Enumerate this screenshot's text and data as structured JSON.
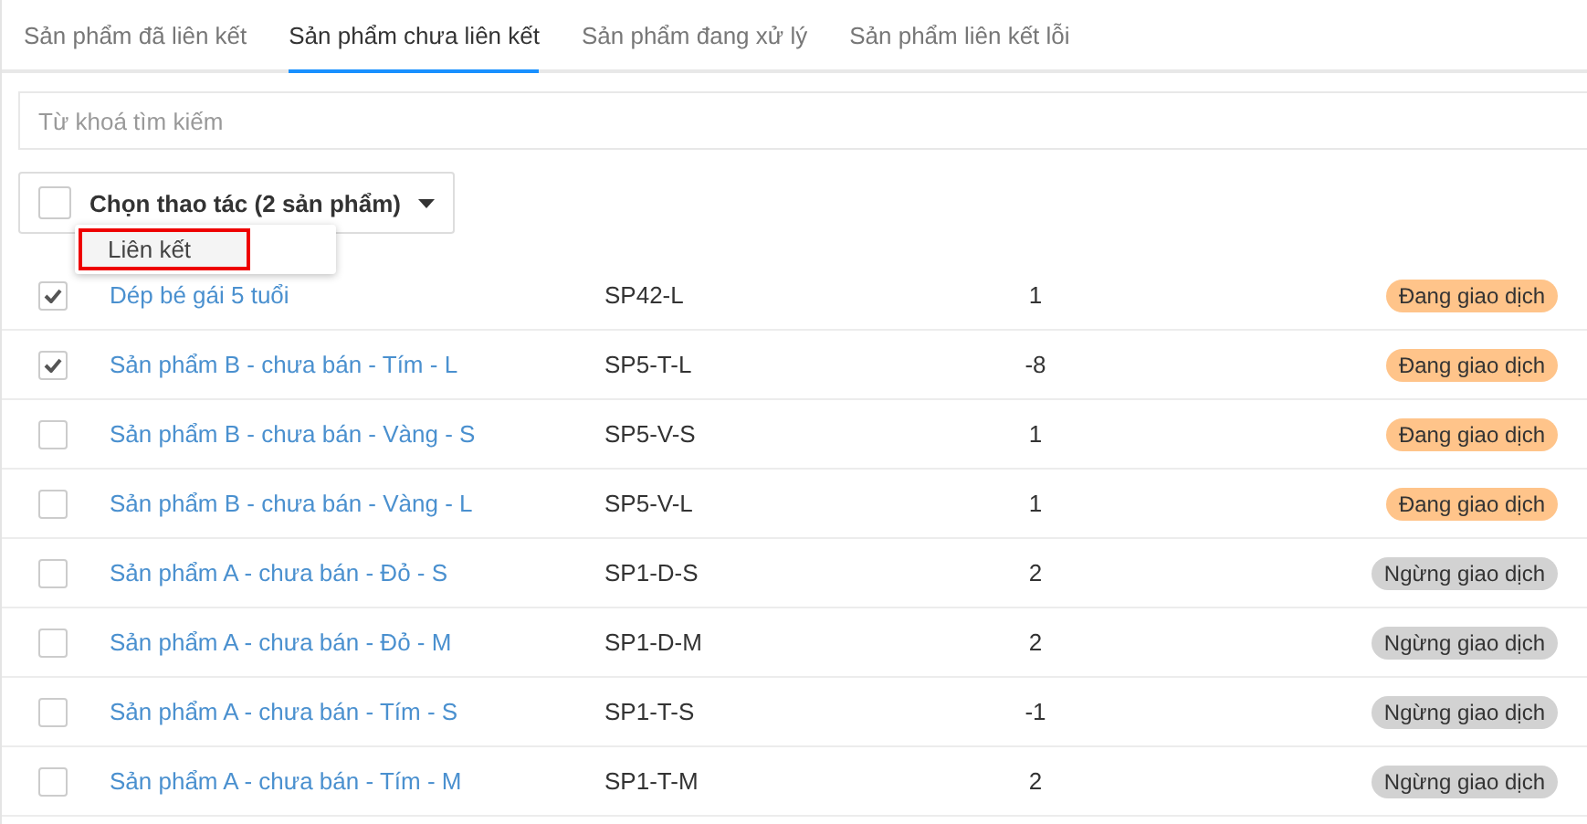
{
  "tabs": [
    {
      "label": "Sản phẩm đã liên kết",
      "selected": false
    },
    {
      "label": "Sản phẩm chưa liên kết",
      "selected": true
    },
    {
      "label": "Sản phẩm đang xử lý",
      "selected": false
    },
    {
      "label": "Sản phẩm liên kết lỗi",
      "selected": false
    }
  ],
  "search": {
    "placeholder": "Từ khoá tìm kiếm"
  },
  "bulk_action": {
    "label": "Chọn thao tác (2 sản phẩm)",
    "checked": false,
    "menu": [
      {
        "label": "Liên kết",
        "highlighted": true
      }
    ]
  },
  "rows": [
    {
      "name": "Dép bé gái 5 tuổi",
      "sku": "SP42-L",
      "quantity": "1",
      "status": "Đang giao dịch",
      "color": "#ffc48a",
      "checked": true
    },
    {
      "name": "Sản phẩm B - chưa bán - Tím - L",
      "sku": "SP5-T-L",
      "quantity": "-8",
      "status": "Đang giao dịch",
      "color": "#ffc48a",
      "checked": true
    },
    {
      "name": "Sản phẩm B - chưa bán - Vàng - S",
      "sku": "SP5-V-S",
      "quantity": "1",
      "status": "Đang giao dịch",
      "color": "#ffc48a",
      "checked": false
    },
    {
      "name": "Sản phẩm B - chưa bán - Vàng - L",
      "sku": "SP5-V-L",
      "quantity": "1",
      "status": "Đang giao dịch",
      "color": "#ffc48a",
      "checked": false
    },
    {
      "name": "Sản phẩm A - chưa bán - Đỏ - S",
      "sku": "SP1-D-S",
      "quantity": "2",
      "status": "Ngừng giao dịch",
      "color": "#d2d2d2",
      "checked": false
    },
    {
      "name": "Sản phẩm A - chưa bán - Đỏ - M",
      "sku": "SP1-D-M",
      "quantity": "2",
      "status": "Ngừng giao dịch",
      "color": "#d2d2d2",
      "checked": false
    },
    {
      "name": "Sản phẩm A - chưa bán - Tím - S",
      "sku": "SP1-T-S",
      "quantity": "-1",
      "status": "Ngừng giao dịch",
      "color": "#d2d2d2",
      "checked": false
    },
    {
      "name": "Sản phẩm A - chưa bán - Tím - M",
      "sku": "SP1-T-M",
      "quantity": "2",
      "status": "Ngừng giao dịch",
      "color": "#d2d2d2",
      "checked": false
    }
  ]
}
